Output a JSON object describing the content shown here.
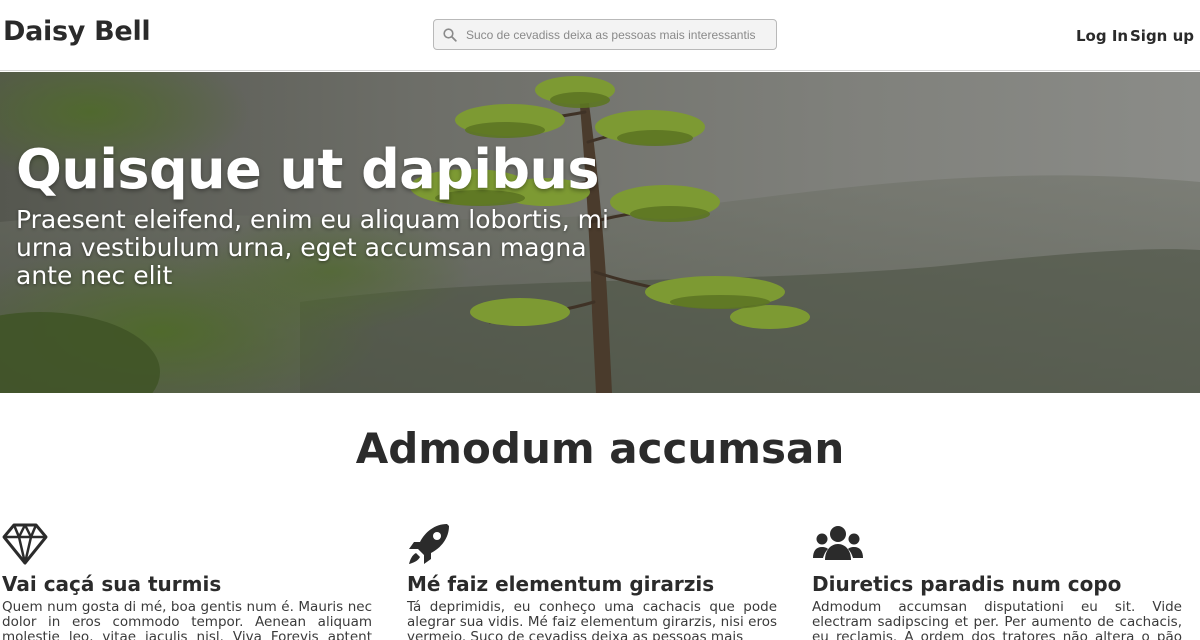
{
  "header": {
    "brand": "Daisy Bell",
    "search": {
      "placeholder": "Suco de cevadiss deixa as pessoas mais interessantis",
      "icon": "search-icon"
    },
    "login_label": "Log In",
    "signup_label": "Sign up"
  },
  "hero": {
    "title": "Quisque ut dapibus",
    "subtitle": "Praesent eleifend, enim eu aliquam lobortis, mi urna vestibulum urna, eget accumsan magna ante nec elit"
  },
  "section": {
    "title": "Admodum accumsan",
    "features": [
      {
        "icon": "diamond-icon",
        "title": "Vai caçá sua turmis",
        "text": "Quem num gosta di mé, boa gentis num é. Mauris nec dolor in eros commodo tempor. Aenean aliquam molestie leo, vitae iaculis nisl. Viva Forevis aptent taciti"
      },
      {
        "icon": "rocket-icon",
        "title": "Mé faiz elementum girarzis",
        "text": "Tá deprimidis, eu conheço uma cachacis que pode alegrar sua vidis. Mé faiz elementum girarzis, nisi eros vermeio. Suco de cevadiss deixa as pessoas mais"
      },
      {
        "icon": "users-icon",
        "title": "Diuretics paradis num copo",
        "text": "Admodum accumsan disputationi eu sit. Vide electram sadipscing et per. Per aumento de cachacis, eu reclamis. A ordem dos tratores não altera o pão duris. Diuretics"
      }
    ]
  },
  "colors": {
    "text": "#2b2b2b",
    "header_border": "#d6d6d6",
    "search_bg": "#f3f3f3",
    "hero_text": "#ffffff"
  }
}
